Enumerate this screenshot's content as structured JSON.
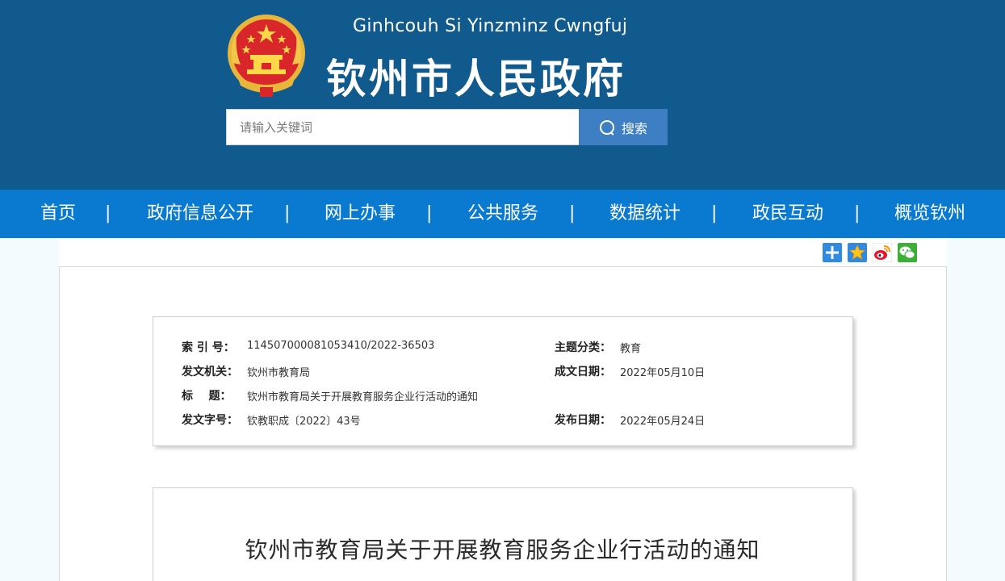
{
  "header": {
    "subtitle": "Ginhcouh Si Yinzminz Cwngfuj",
    "title": "钦州市人民政府",
    "search_placeholder": "请输入关键词",
    "search_button": "搜索"
  },
  "nav": {
    "items": [
      "首页",
      "政府信息公开",
      "网上办事",
      "公共服务",
      "数据统计",
      "政民互动",
      "概览钦州"
    ],
    "separator": "|"
  },
  "share_icons": [
    "plus-share-icon",
    "qzone-star-icon",
    "weibo-icon",
    "wechat-icon"
  ],
  "info": {
    "index_label": "索 引 号：",
    "index_value": "114507000081053410/2022-36503",
    "category_label": "主题分类：",
    "category_value": "教育",
    "issuer_label": "发文机关：",
    "issuer_value": "钦州市教育局",
    "created_label": "成文日期：",
    "created_value": "2022年05月10日",
    "title_label": "标    题：",
    "title_value": "钦州市教育局关于开展教育服务企业行活动的通知",
    "docno_label": "发文字号：",
    "docno_value": "钦教职成〔2022〕43号",
    "published_label": "发布日期：",
    "published_value": "2022年05月24日"
  },
  "article": {
    "title": "钦州市教育局关于开展教育服务企业行活动的通知"
  },
  "colors": {
    "header_bg": "#115a8e",
    "nav_bg": "#0a7ad0",
    "search_button_bg": "#3d7fc2",
    "page_bg": "#f4fbfe"
  }
}
